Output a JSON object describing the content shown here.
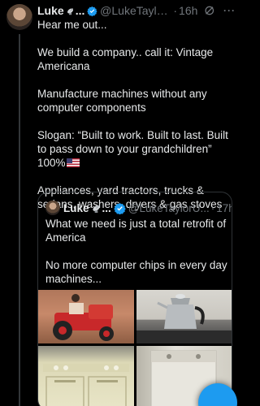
{
  "tweet": {
    "author_name": "Luke",
    "author_emoji": "satellite-dish-emoji",
    "name_ellipsis": "...",
    "handle": "@LukeTaylorU...",
    "separator": "·",
    "time": "16h",
    "more_label": "···",
    "verified_icon": "verified-badge-icon",
    "body": {
      "line1": "Hear me out...",
      "para2": "We build a company.. call it: Vintage Americana",
      "para3": "Manufacture machines without any computer components",
      "para4": "Slogan: “Built to work. Built to last. Built to pass down to your grandchildren” 100%",
      "para5": "Appliances, yard tractors, trucks & sedans, washers, dryers & gas stoves"
    }
  },
  "quoted": {
    "author_name": "Luke",
    "name_ellipsis": "...",
    "handle": "@LukeTaylorU...",
    "separator": "·",
    "time": "17h",
    "para1": "What we need is just a total retrofit of America",
    "para2": "No more computer chips in every day machines..."
  },
  "colors": {
    "background": "#000000",
    "text": "#e7e9ea",
    "muted": "#71767b",
    "accent": "#1d9bf0",
    "border": "#2f3336"
  }
}
